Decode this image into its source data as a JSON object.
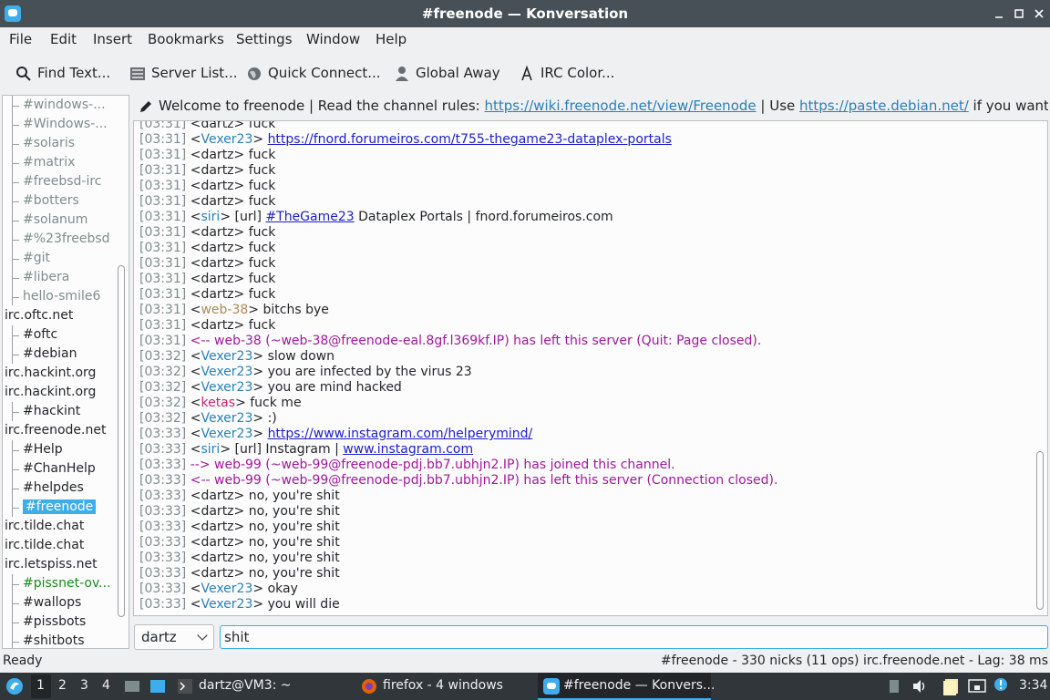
{
  "window": {
    "title": "#freenode — Konversation",
    "controls": {
      "minimize": "_",
      "maximize": "□",
      "close": "✕"
    }
  },
  "menu": [
    "File",
    "Edit",
    "Insert",
    "Bookmarks",
    "Settings",
    "Window",
    "Help"
  ],
  "toolbar": {
    "find": "Find Text...",
    "server_list": "Server List...",
    "quick_connect": "Quick Connect...",
    "global_away": "Global Away",
    "irc_color": "IRC Color..."
  },
  "tree": [
    {
      "label": "#windows-...",
      "type": "channel",
      "color": "#7f8c8d"
    },
    {
      "label": "#Windows-...",
      "type": "channel",
      "color": "#7f8c8d"
    },
    {
      "label": "#solaris",
      "type": "channel",
      "color": "#7f8c8d"
    },
    {
      "label": "#matrix",
      "type": "channel",
      "color": "#7f8c8d"
    },
    {
      "label": "#freebsd-irc",
      "type": "channel",
      "color": "#7f8c8d"
    },
    {
      "label": "#botters",
      "type": "channel",
      "color": "#7f8c8d"
    },
    {
      "label": "#solanum",
      "type": "channel",
      "color": "#7f8c8d"
    },
    {
      "label": "#%23freebsd",
      "type": "channel",
      "color": "#7f8c8d"
    },
    {
      "label": "#git",
      "type": "channel",
      "color": "#7f8c8d"
    },
    {
      "label": "#libera",
      "type": "channel",
      "color": "#7f8c8d"
    },
    {
      "label": "hello-smile6",
      "type": "channel",
      "color": "#7f8c8d"
    },
    {
      "label": "irc.oftc.net",
      "type": "server"
    },
    {
      "label": "#oftc",
      "type": "channel",
      "color": "#232629"
    },
    {
      "label": "#debian",
      "type": "channel",
      "color": "#232629"
    },
    {
      "label": "irc.hackint.org",
      "type": "server"
    },
    {
      "label": "irc.hackint.org",
      "type": "server"
    },
    {
      "label": "#hackint",
      "type": "channel",
      "color": "#232629"
    },
    {
      "label": "irc.freenode.net",
      "type": "server"
    },
    {
      "label": "#Help",
      "type": "channel",
      "color": "#232629"
    },
    {
      "label": "#ChanHelp",
      "type": "channel",
      "color": "#232629"
    },
    {
      "label": "#helpdes",
      "type": "channel",
      "color": "#232629"
    },
    {
      "label": "#freenode",
      "type": "channel",
      "color": "#ffffff",
      "selected": true
    },
    {
      "label": "irc.tilde.chat",
      "type": "server"
    },
    {
      "label": "irc.tilde.chat",
      "type": "server"
    },
    {
      "label": "irc.letspiss.net",
      "type": "server"
    },
    {
      "label": "#pissnet-ov...",
      "type": "channel",
      "color": "#1a8a1a"
    },
    {
      "label": "#wallops",
      "type": "channel",
      "color": "#232629"
    },
    {
      "label": "#pissbots",
      "type": "channel",
      "color": "#232629"
    },
    {
      "label": "#shitbots",
      "type": "channel",
      "color": "#232629"
    }
  ],
  "topic": {
    "prefix": "Welcome to freenode | Read the channel rules: ",
    "link1": "https://wiki.freenode.net/view/Freenode",
    "middle": " | Use ",
    "link2": "https://paste.debian.net/",
    "suffix": " if you want to post ..."
  },
  "messages": [
    {
      "ts": "[03:31]",
      "nick": "dartz",
      "nick_color": "#232629",
      "parts": [
        {
          "t": "fuck"
        }
      ]
    },
    {
      "ts": "[03:31]",
      "nick": "Vexer23",
      "nick_color": "#2980b9",
      "parts": [
        {
          "t": "https://fnord.forumeiros.com/t755-thegame23-dataplex-portals",
          "link": true
        }
      ]
    },
    {
      "ts": "[03:31]",
      "nick": "dartz",
      "nick_color": "#232629",
      "parts": [
        {
          "t": "fuck"
        }
      ]
    },
    {
      "ts": "[03:31]",
      "nick": "dartz",
      "nick_color": "#232629",
      "parts": [
        {
          "t": "fuck"
        }
      ]
    },
    {
      "ts": "[03:31]",
      "nick": "dartz",
      "nick_color": "#232629",
      "parts": [
        {
          "t": "fuck"
        }
      ]
    },
    {
      "ts": "[03:31]",
      "nick": "dartz",
      "nick_color": "#232629",
      "parts": [
        {
          "t": "fuck"
        }
      ]
    },
    {
      "ts": "[03:31]",
      "nick": "siri",
      "nick_color": "#2980b9",
      "parts": [
        {
          "t": "[url] "
        },
        {
          "t": "#TheGame23",
          "link": true
        },
        {
          "t": " Dataplex Portals | fnord.forumeiros.com"
        }
      ]
    },
    {
      "ts": "[03:31]",
      "nick": "dartz",
      "nick_color": "#232629",
      "parts": [
        {
          "t": "fuck"
        }
      ]
    },
    {
      "ts": "[03:31]",
      "nick": "dartz",
      "nick_color": "#232629",
      "parts": [
        {
          "t": "fuck"
        }
      ]
    },
    {
      "ts": "[03:31]",
      "nick": "dartz",
      "nick_color": "#232629",
      "parts": [
        {
          "t": "fuck"
        }
      ]
    },
    {
      "ts": "[03:31]",
      "nick": "dartz",
      "nick_color": "#232629",
      "parts": [
        {
          "t": "fuck"
        }
      ]
    },
    {
      "ts": "[03:31]",
      "nick": "dartz",
      "nick_color": "#232629",
      "parts": [
        {
          "t": "fuck"
        }
      ]
    },
    {
      "ts": "[03:31]",
      "nick": "web-38",
      "nick_color": "#b08a5a",
      "parts": [
        {
          "t": "bitchs  bye"
        }
      ]
    },
    {
      "ts": "[03:31]",
      "nick": "dartz",
      "nick_color": "#232629",
      "parts": [
        {
          "t": "fuck"
        }
      ]
    },
    {
      "ts": "[03:31]",
      "sys": "<-- web-38 (~web-38@freenode-eal.8gf.l369kf.IP) has left this server (Quit: Page closed)."
    },
    {
      "ts": "[03:32]",
      "nick": "Vexer23",
      "nick_color": "#2980b9",
      "parts": [
        {
          "t": "slow down"
        }
      ]
    },
    {
      "ts": "[03:32]",
      "nick": "Vexer23",
      "nick_color": "#2980b9",
      "parts": [
        {
          "t": "you are infected by the virus 23"
        }
      ]
    },
    {
      "ts": "[03:32]",
      "nick": "Vexer23",
      "nick_color": "#2980b9",
      "parts": [
        {
          "t": "you are mind hacked"
        }
      ]
    },
    {
      "ts": "[03:32]",
      "nick": "ketas",
      "nick_color": "#c0266b",
      "parts": [
        {
          "t": "fuck me"
        }
      ]
    },
    {
      "ts": "[03:32]",
      "nick": "Vexer23",
      "nick_color": "#2980b9",
      "parts": [
        {
          "t": ":)"
        }
      ]
    },
    {
      "ts": "[03:33]",
      "nick": "Vexer23",
      "nick_color": "#2980b9",
      "parts": [
        {
          "t": "https://www.instagram.com/helperymind/",
          "link": true
        }
      ]
    },
    {
      "ts": "[03:33]",
      "nick": "siri",
      "nick_color": "#2980b9",
      "parts": [
        {
          "t": "[url] Instagram | "
        },
        {
          "t": "www.instagram.com",
          "link": true
        }
      ]
    },
    {
      "ts": "[03:33]",
      "sys": "--> web-99 (~web-99@freenode-pdj.bb7.ubhjn2.IP) has joined this channel."
    },
    {
      "ts": "[03:33]",
      "sys": "<-- web-99 (~web-99@freenode-pdj.bb7.ubhjn2.IP) has left this server (Connection closed)."
    },
    {
      "ts": "[03:33]",
      "nick": "dartz",
      "nick_color": "#232629",
      "parts": [
        {
          "t": "no, you're shit"
        }
      ]
    },
    {
      "ts": "[03:33]",
      "nick": "dartz",
      "nick_color": "#232629",
      "parts": [
        {
          "t": "no, you're shit"
        }
      ]
    },
    {
      "ts": "[03:33]",
      "nick": "dartz",
      "nick_color": "#232629",
      "parts": [
        {
          "t": "no, you're shit"
        }
      ]
    },
    {
      "ts": "[03:33]",
      "nick": "dartz",
      "nick_color": "#232629",
      "parts": [
        {
          "t": "no, you're shit"
        }
      ]
    },
    {
      "ts": "[03:33]",
      "nick": "dartz",
      "nick_color": "#232629",
      "parts": [
        {
          "t": "no, you're shit"
        }
      ]
    },
    {
      "ts": "[03:33]",
      "nick": "dartz",
      "nick_color": "#232629",
      "parts": [
        {
          "t": "no, you're shit"
        }
      ]
    },
    {
      "ts": "[03:33]",
      "nick": "Vexer23",
      "nick_color": "#2980b9",
      "parts": [
        {
          "t": "okay"
        }
      ]
    },
    {
      "ts": "[03:33]",
      "nick": "Vexer23",
      "nick_color": "#2980b9",
      "parts": [
        {
          "t": "you will die"
        }
      ]
    }
  ],
  "input": {
    "nick": "dartz",
    "text": "shit"
  },
  "status": {
    "left": "Ready",
    "right": "#freenode - 330 nicks (11 ops)  irc.freenode.net - Lag: 38 ms"
  },
  "taskbar": {
    "workspaces": [
      "1",
      "2",
      "3",
      "4"
    ],
    "tasks": [
      "dartz@VM3: ~",
      "firefox - 4 windows",
      "#freenode — Konvers..."
    ],
    "clock": "3:34"
  }
}
